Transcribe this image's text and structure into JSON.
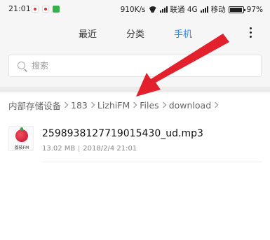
{
  "status_bar": {
    "time": "21:01",
    "speed": "910K/s",
    "carrier1": "联通 4G",
    "carrier2": "移动",
    "battery_percent": "97%",
    "battery_level": 0.97,
    "notification_icons": [
      "red-dot-icon",
      "red-dot-icon",
      "green-app-icon"
    ]
  },
  "tabs": [
    {
      "label": "最近"
    },
    {
      "label": "分类"
    },
    {
      "label": "手机",
      "active": true
    }
  ],
  "menu_icon": "more-vertical-icon",
  "search": {
    "placeholder": "搜索",
    "value": ""
  },
  "breadcrumb": [
    "内部存储设备",
    "183",
    "LizhiFM",
    "Files",
    "download"
  ],
  "files": [
    {
      "name": "2598938127719015430_ud.mp3",
      "size": "13.02 MB",
      "date": "2018/2/4 21:01",
      "thumb_text": "荔枝FM",
      "icon": "lizhi-fm-icon"
    }
  ],
  "annotation": {
    "icon": "red-arrow-icon",
    "color": "#e3212d"
  },
  "colors": {
    "accent": "#2c86f5",
    "background": "#f6f6f6"
  }
}
